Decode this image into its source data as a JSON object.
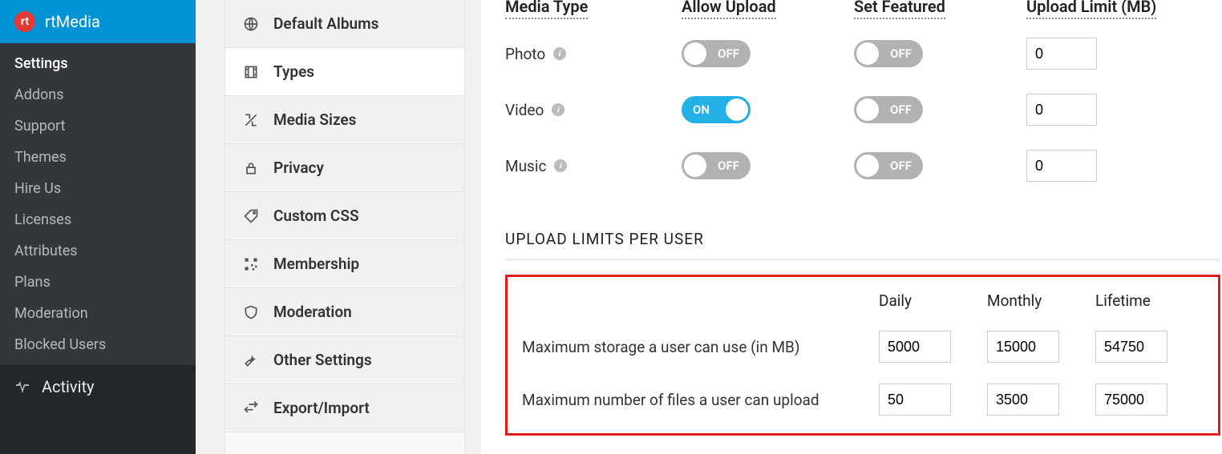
{
  "brand": {
    "logo_text": "rt",
    "name": "rtMedia"
  },
  "sidebar": {
    "items": [
      {
        "label": "Settings",
        "active": true
      },
      {
        "label": "Addons"
      },
      {
        "label": "Support"
      },
      {
        "label": "Themes"
      },
      {
        "label": "Hire Us"
      },
      {
        "label": "Licenses"
      },
      {
        "label": "Attributes"
      },
      {
        "label": "Plans"
      },
      {
        "label": "Moderation"
      },
      {
        "label": "Blocked Users"
      }
    ],
    "bottom_item": "Activity"
  },
  "tabs": [
    {
      "label": "Default Albums",
      "icon": "globe"
    },
    {
      "label": "Types",
      "icon": "film",
      "active": true
    },
    {
      "label": "Media Sizes",
      "icon": "resize"
    },
    {
      "label": "Privacy",
      "icon": "lock"
    },
    {
      "label": "Custom CSS",
      "icon": "tag"
    },
    {
      "label": "Membership",
      "icon": "qr"
    },
    {
      "label": "Moderation",
      "icon": "shield"
    },
    {
      "label": "Other Settings",
      "icon": "wrench"
    },
    {
      "label": "Export/Import",
      "icon": "transfer"
    }
  ],
  "media_table": {
    "headers": {
      "type": "Media Type",
      "allow": "Allow Upload",
      "featured": "Set Featured",
      "limit": "Upload Limit (MB)"
    },
    "rows": [
      {
        "name": "Photo",
        "allow": "OFF",
        "featured": "OFF",
        "limit": "0"
      },
      {
        "name": "Video",
        "allow": "ON",
        "featured": "OFF",
        "limit": "0"
      },
      {
        "name": "Music",
        "allow": "OFF",
        "featured": "OFF",
        "limit": "0"
      }
    ]
  },
  "limits": {
    "title": "UPLOAD LIMITS PER USER",
    "headers": {
      "daily": "Daily",
      "monthly": "Monthly",
      "lifetime": "Lifetime"
    },
    "rows": [
      {
        "label": "Maximum storage a user can use (in MB)",
        "daily": "5000",
        "monthly": "15000",
        "lifetime": "54750"
      },
      {
        "label": "Maximum number of files a user can upload",
        "daily": "50",
        "monthly": "3500",
        "lifetime": "75000"
      }
    ]
  }
}
